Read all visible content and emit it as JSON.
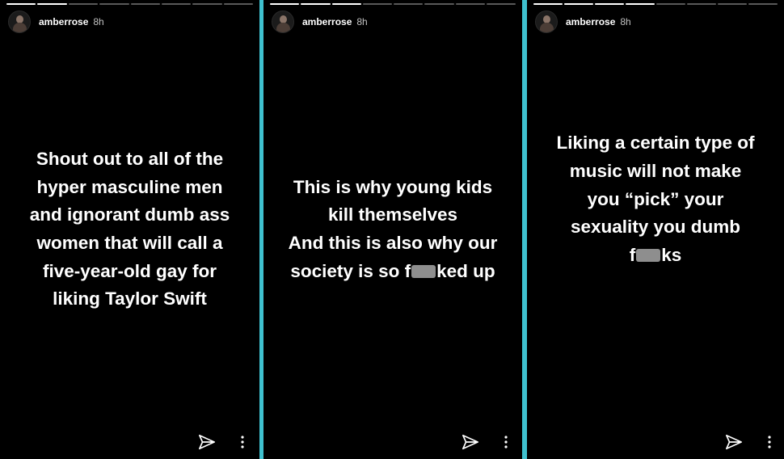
{
  "stories": [
    {
      "username": "amberrose",
      "time": "8h",
      "lines": [
        [
          "Shout out to all of the"
        ],
        [
          "hyper masculine men"
        ],
        [
          "and ignorant dumb ass"
        ],
        [
          "women that will call a"
        ],
        [
          "five-year-old gay for"
        ],
        [
          "liking Taylor Swift"
        ]
      ]
    },
    {
      "username": "amberrose",
      "time": "8h",
      "lines": [
        [
          "This is why young kids"
        ],
        [
          "kill themselves"
        ],
        [
          "And this is also why our"
        ],
        [
          "society is so f",
          "ked up"
        ]
      ]
    },
    {
      "username": "amberrose",
      "time": "8h",
      "lines": [
        [
          "Liking a certain type of"
        ],
        [
          "music will not make"
        ],
        [
          "you “pick” your"
        ],
        [
          "sexuality you dumb"
        ],
        [
          "f",
          "ks"
        ]
      ]
    }
  ]
}
